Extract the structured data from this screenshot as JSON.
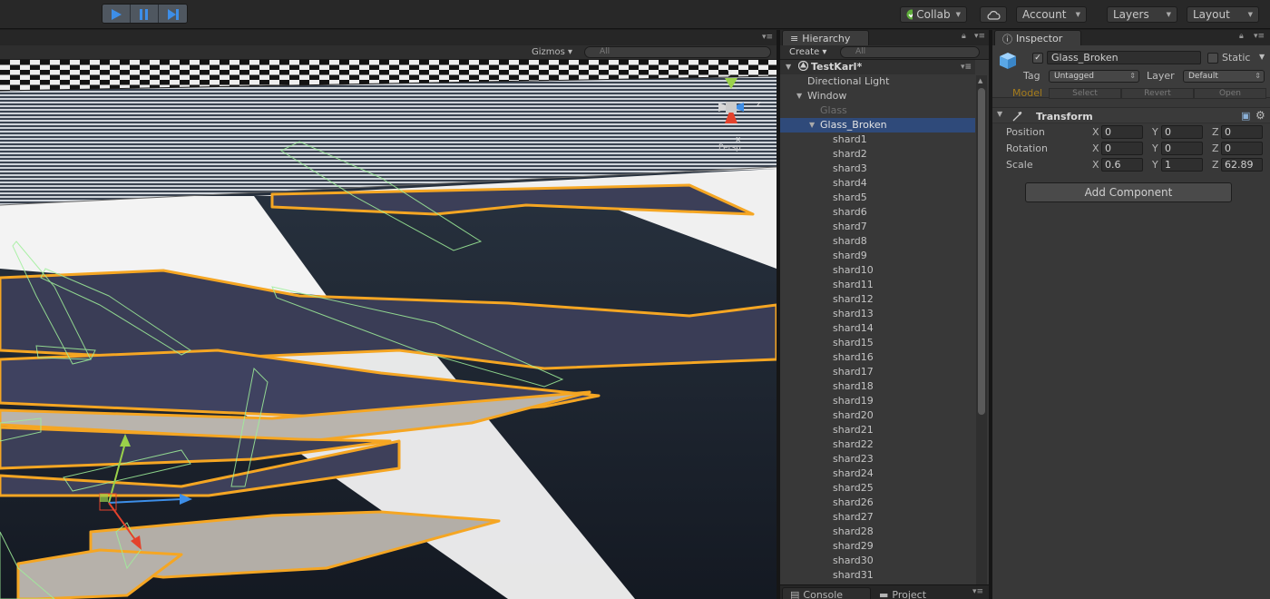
{
  "toolbar": {
    "play_icon": "play-icon",
    "pause_icon": "pause-icon",
    "step_icon": "step-icon",
    "collab_label": "Collab",
    "cloud_icon": "cloud-icon",
    "account_label": "Account",
    "layers_label": "Layers",
    "layout_label": "Layout"
  },
  "scene": {
    "gizmos_label": "Gizmos",
    "search_placeholder": "All",
    "orientation": {
      "y": "y",
      "x": "x",
      "z": "z",
      "persp": "Persp"
    }
  },
  "hierarchy": {
    "tab_label": "Hierarchy",
    "create_label": "Create",
    "search_placeholder": "All",
    "scene_name": "TestKarl*",
    "items": [
      {
        "label": "Directional Light",
        "depth": 1,
        "state": "normal",
        "fold": ""
      },
      {
        "label": "Window",
        "depth": 1,
        "state": "normal",
        "fold": "open"
      },
      {
        "label": "Glass",
        "depth": 2,
        "state": "disabled",
        "fold": ""
      },
      {
        "label": "Glass_Broken",
        "depth": 2,
        "state": "selected",
        "fold": "open"
      },
      {
        "label": "shard1",
        "depth": 3,
        "state": "normal",
        "fold": ""
      },
      {
        "label": "shard2",
        "depth": 3,
        "state": "normal",
        "fold": ""
      },
      {
        "label": "shard3",
        "depth": 3,
        "state": "normal",
        "fold": ""
      },
      {
        "label": "shard4",
        "depth": 3,
        "state": "normal",
        "fold": ""
      },
      {
        "label": "shard5",
        "depth": 3,
        "state": "normal",
        "fold": ""
      },
      {
        "label": "shard6",
        "depth": 3,
        "state": "normal",
        "fold": ""
      },
      {
        "label": "shard7",
        "depth": 3,
        "state": "normal",
        "fold": ""
      },
      {
        "label": "shard8",
        "depth": 3,
        "state": "normal",
        "fold": ""
      },
      {
        "label": "shard9",
        "depth": 3,
        "state": "normal",
        "fold": ""
      },
      {
        "label": "shard10",
        "depth": 3,
        "state": "normal",
        "fold": ""
      },
      {
        "label": "shard11",
        "depth": 3,
        "state": "normal",
        "fold": ""
      },
      {
        "label": "shard12",
        "depth": 3,
        "state": "normal",
        "fold": ""
      },
      {
        "label": "shard13",
        "depth": 3,
        "state": "normal",
        "fold": ""
      },
      {
        "label": "shard14",
        "depth": 3,
        "state": "normal",
        "fold": ""
      },
      {
        "label": "shard15",
        "depth": 3,
        "state": "normal",
        "fold": ""
      },
      {
        "label": "shard16",
        "depth": 3,
        "state": "normal",
        "fold": ""
      },
      {
        "label": "shard17",
        "depth": 3,
        "state": "normal",
        "fold": ""
      },
      {
        "label": "shard18",
        "depth": 3,
        "state": "normal",
        "fold": ""
      },
      {
        "label": "shard19",
        "depth": 3,
        "state": "normal",
        "fold": ""
      },
      {
        "label": "shard20",
        "depth": 3,
        "state": "normal",
        "fold": ""
      },
      {
        "label": "shard21",
        "depth": 3,
        "state": "normal",
        "fold": ""
      },
      {
        "label": "shard22",
        "depth": 3,
        "state": "normal",
        "fold": ""
      },
      {
        "label": "shard23",
        "depth": 3,
        "state": "normal",
        "fold": ""
      },
      {
        "label": "shard24",
        "depth": 3,
        "state": "normal",
        "fold": ""
      },
      {
        "label": "shard25",
        "depth": 3,
        "state": "normal",
        "fold": ""
      },
      {
        "label": "shard26",
        "depth": 3,
        "state": "normal",
        "fold": ""
      },
      {
        "label": "shard27",
        "depth": 3,
        "state": "normal",
        "fold": ""
      },
      {
        "label": "shard28",
        "depth": 3,
        "state": "normal",
        "fold": ""
      },
      {
        "label": "shard29",
        "depth": 3,
        "state": "normal",
        "fold": ""
      },
      {
        "label": "shard30",
        "depth": 3,
        "state": "normal",
        "fold": ""
      },
      {
        "label": "shard31",
        "depth": 3,
        "state": "normal",
        "fold": ""
      }
    ]
  },
  "bottom_tabs": {
    "console_label": "Console",
    "project_label": "Project"
  },
  "inspector": {
    "tab_label": "Inspector",
    "object_name": "Glass_Broken",
    "active_checked": true,
    "static_label": "Static",
    "static_checked": false,
    "tag_label": "Tag",
    "tag_value": "Untagged",
    "layer_label": "Layer",
    "layer_value": "Default",
    "model_label": "Model",
    "model_buttons": [
      "Select",
      "Revert",
      "Open"
    ],
    "transform": {
      "title": "Transform",
      "axis_labels": [
        "X",
        "Y",
        "Z"
      ],
      "rows": [
        {
          "label": "Position",
          "x": "0",
          "y": "0",
          "z": "0"
        },
        {
          "label": "Rotation",
          "x": "0",
          "y": "0",
          "z": "0"
        },
        {
          "label": "Scale",
          "x": "0.6",
          "y": "1",
          "z": "62.89"
        }
      ]
    },
    "add_component_label": "Add Component"
  },
  "colors": {
    "selection_outline": "#f5a623",
    "collider_wire": "#9ff09a",
    "selected_row": "#2f4a7a",
    "play_blue": "#3d8ee8"
  }
}
